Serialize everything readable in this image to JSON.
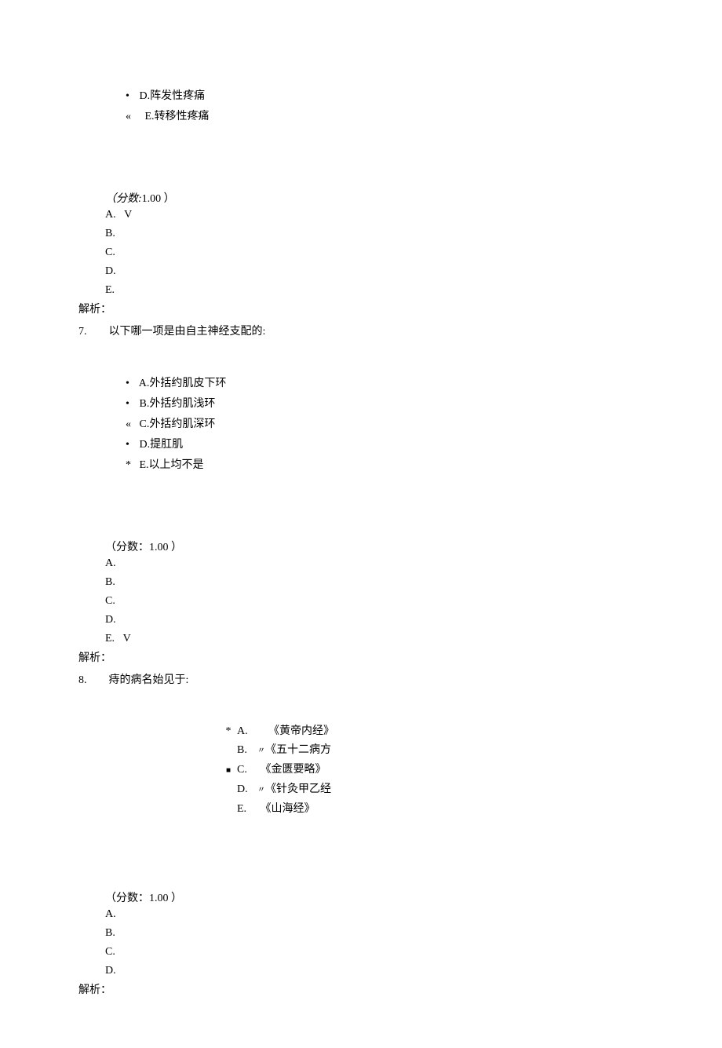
{
  "q6_tail": {
    "d": "D.阵发性疼痛",
    "e": "E.转移性疼痛"
  },
  "score_label_italic": "（分数:",
  "score_label_normal": "（分数：",
  "score_value": "1.00 ）",
  "letters": {
    "a": "A.",
    "b": "B.",
    "c": "C.",
    "d": "D.",
    "e": "E."
  },
  "check": "V",
  "analysis": "解析：",
  "q7": {
    "num": "7.",
    "stem": "以下哪一项是由自主神经支配的:",
    "a": "A.外括约肌皮下环",
    "b": "B.外括约肌浅环",
    "c": "C.外括约肌深环",
    "d": "D.提肛肌",
    "e": "E.以上均不是"
  },
  "q8": {
    "num": "8.",
    "stem": "痔的病名始见于:",
    "a": "《黄帝内经》",
    "b": "《五十二病方",
    "c": "《金匮要略》",
    "d": "《针灸甲乙经",
    "e": "《山海经》"
  },
  "small_mark": "〃"
}
